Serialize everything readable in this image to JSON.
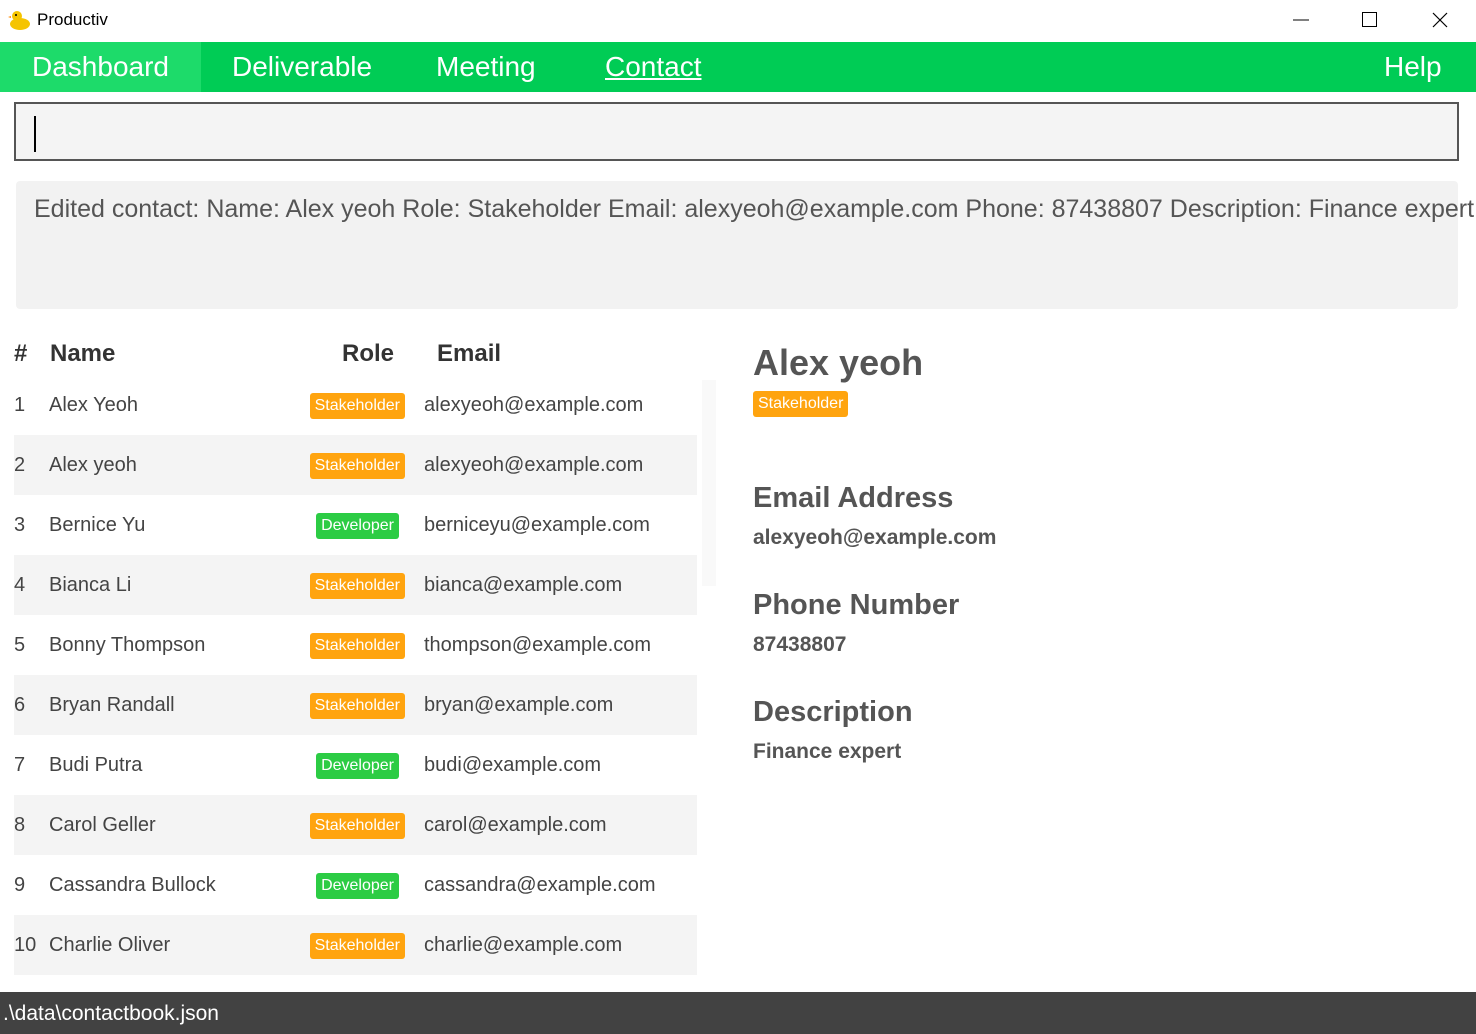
{
  "window": {
    "title": "Productiv",
    "controls": [
      "minimize-icon",
      "maximize-icon",
      "close-icon"
    ]
  },
  "menu": {
    "items": [
      {
        "label": "Dashboard"
      },
      {
        "label": "Deliverable"
      },
      {
        "label": "Meeting"
      },
      {
        "label": "Contact"
      }
    ],
    "help": "Help"
  },
  "command": {
    "value": ""
  },
  "result": {
    "text": "Edited contact: Name: Alex yeoh Role: Stakeholder Email: alexyeoh@example.com Phone: 87438807 Description: Finance expert"
  },
  "table": {
    "headers": {
      "index": "#",
      "name": "Name",
      "role": "Role",
      "email": "Email"
    },
    "rows": [
      {
        "index": "1",
        "name": "Alex Yeoh",
        "role": "Stakeholder",
        "email": "alexyeoh@example.com"
      },
      {
        "index": "2",
        "name": "Alex yeoh",
        "role": "Stakeholder",
        "email": "alexyeoh@example.com"
      },
      {
        "index": "3",
        "name": "Bernice Yu",
        "role": "Developer",
        "email": "berniceyu@example.com"
      },
      {
        "index": "4",
        "name": "Bianca Li",
        "role": "Stakeholder",
        "email": "bianca@example.com"
      },
      {
        "index": "5",
        "name": "Bonny Thompson",
        "role": "Stakeholder",
        "email": "thompson@example.com"
      },
      {
        "index": "6",
        "name": "Bryan Randall",
        "role": "Stakeholder",
        "email": "bryan@example.com"
      },
      {
        "index": "7",
        "name": "Budi Putra",
        "role": "Developer",
        "email": "budi@example.com"
      },
      {
        "index": "8",
        "name": "Carol Geller",
        "role": "Stakeholder",
        "email": "carol@example.com"
      },
      {
        "index": "9",
        "name": "Cassandra Bullock",
        "role": "Developer",
        "email": "cassandra@example.com"
      },
      {
        "index": "10",
        "name": "Charlie Oliver",
        "role": "Stakeholder",
        "email": "charlie@example.com"
      }
    ]
  },
  "detail": {
    "name": "Alex yeoh",
    "role": "Stakeholder",
    "email_heading": "Email Address",
    "email": "alexyeoh@example.com",
    "phone_heading": "Phone Number",
    "phone": "87438807",
    "description_heading": "Description",
    "description": "Finance expert"
  },
  "status": {
    "path": ".\\data\\contactbook.json"
  },
  "colors": {
    "menu_bg": "#00cc55",
    "menu_active": "#1ddb6a",
    "stakeholder": "#ffa40f",
    "developer": "#2ccc44",
    "status_bg": "#424242"
  }
}
